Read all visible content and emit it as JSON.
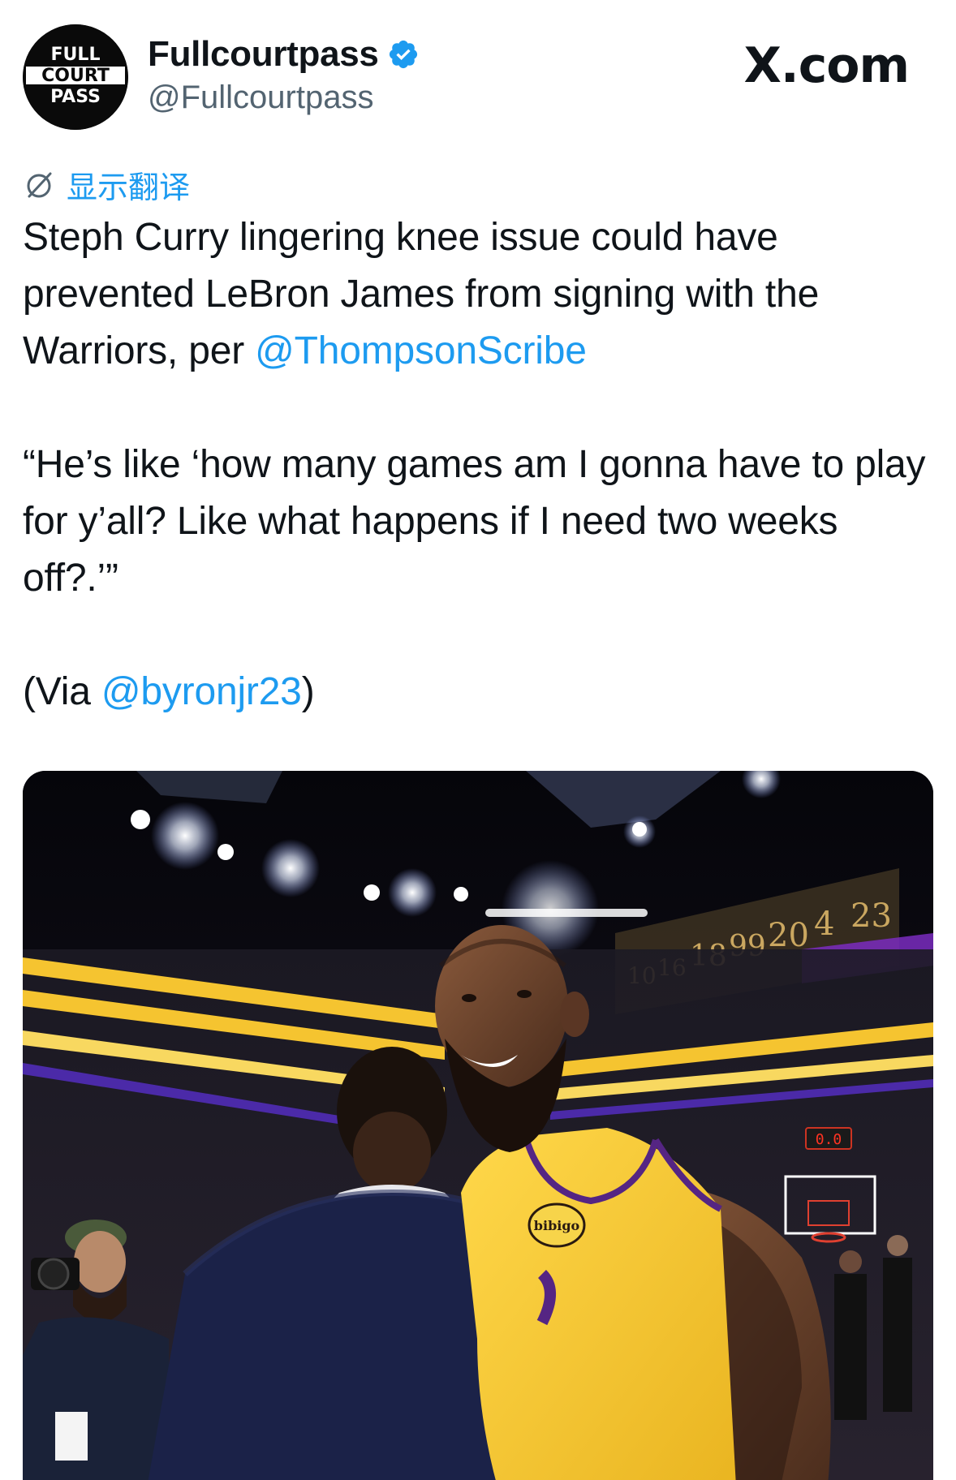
{
  "header": {
    "avatar_text": [
      "FULL",
      "COURT",
      "PASS"
    ],
    "display_name": "Fullcourtpass",
    "handle": "@Fullcourtpass",
    "site_mark": "X.com"
  },
  "translate": {
    "label": "显示翻译"
  },
  "tweet": {
    "line1_prefix": "Steph Curry lingering knee issue could have prevented LeBron James from signing with the Warriors, per ",
    "mention1": "@ThompsonScribe",
    "quote": "“He’s like ‘how many games am I gonna have to play for y’all? Like what happens if I need two weeks off?.’”",
    "via_prefix": "(Via ",
    "mention2": "@byronjr23",
    "via_suffix": ")"
  },
  "media": {
    "jersey_sponsor": "bibigo",
    "banner_numbers": [
      "10",
      "16",
      "18",
      "99",
      "20",
      "4",
      "23"
    ],
    "shot_clock": "0.0"
  },
  "colors": {
    "link": "#1d9bf0",
    "verified": "#1d9bf0",
    "text_primary": "#0f1419",
    "text_secondary": "#536471",
    "lakers_gold": "#f5c430",
    "lakers_purple": "#552583"
  },
  "icons": {
    "verified": "verified-badge-icon",
    "translate": "translate-globe-icon"
  }
}
